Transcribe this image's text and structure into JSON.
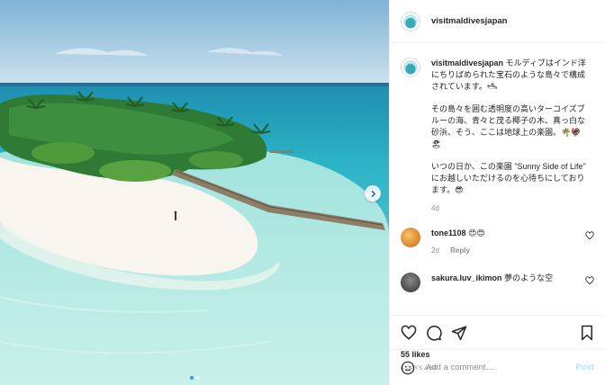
{
  "post": {
    "username": "visitmaldivesjapan",
    "caption": {
      "username": "visitmaldivesjapan",
      "p1": "モルディブはインド洋にちりばめられた宝石のような島々で構成されています。🛥",
      "p2": "その島々を囲む透明度の高いターコイズブルーの海、青々と茂る椰子の木、真っ白な砂浜、そう、ここは地球上の楽園。🌴🦃🏖",
      "p3": "いつの日か、この楽園 \"Sunny Side of Life\" にお越しいただけるのを心待ちにしております。😎",
      "time": "4d"
    },
    "comments": [
      {
        "username": "tone1108",
        "text": "😍😍",
        "time": "2d",
        "reply": "Reply"
      },
      {
        "username": "sakura.luv_ikimon",
        "text": "夢のような空"
      }
    ],
    "likes": "55 likes",
    "date": "4 DAYS AGO",
    "add_comment": {
      "placeholder": "Add a comment…",
      "post_label": "Post"
    }
  },
  "icons": {
    "like": "heart-icon",
    "comment": "comment-icon",
    "share": "share-icon",
    "save": "bookmark-icon",
    "emoji": "emoji-icon",
    "next": "chevron-right-icon"
  },
  "colors": {
    "accent": "#3897f0",
    "post_disabled": "#b2dffc",
    "muted": "#8e8e8e"
  },
  "carousel": {
    "slides": 2,
    "active": 1
  }
}
